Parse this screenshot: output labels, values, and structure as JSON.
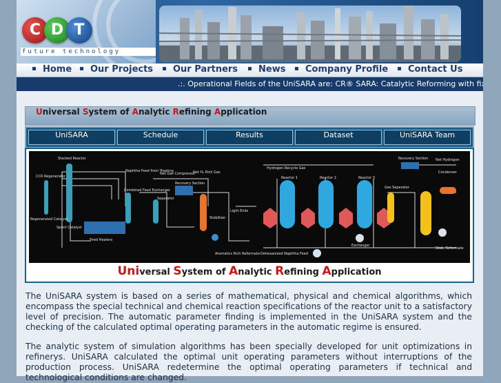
{
  "header": {
    "logo": {
      "letters": [
        "C",
        "D",
        "T"
      ],
      "tagline": "future technology"
    }
  },
  "nav": {
    "items": [
      "Home",
      "Our Projects",
      "Our Partners",
      "News",
      "Company Profile",
      "Contact Us"
    ]
  },
  "ticker": {
    "text": ".:. Operational Fields of the UniSARA are: CR® SARA: Catalytic Reforming with fixe"
  },
  "app": {
    "title_parts": [
      {
        "hl": "U",
        "rest": "niversal "
      },
      {
        "hl": "S",
        "rest": "ystem of "
      },
      {
        "hl": "A",
        "rest": "nalytic "
      },
      {
        "hl": "R",
        "rest": "efining "
      },
      {
        "hl": "A",
        "rest": "pplication"
      }
    ],
    "tabs": [
      "UniSARA",
      "Schedule",
      "Results",
      "Dataset",
      "UniSARA Team"
    ]
  },
  "diagram": {
    "caption_parts": [
      {
        "hl": "Uni",
        "rest": "versal "
      },
      {
        "hl": "S",
        "rest": "ystem of "
      },
      {
        "hl": "A",
        "rest": "nalytic "
      },
      {
        "hl": "R",
        "rest": "efining "
      },
      {
        "hl": "A",
        "rest": "pplication"
      }
    ],
    "labels": {
      "stacked_reactor": "Stacked Reactor",
      "ccr": "CCR Regenerator",
      "regen_catalyst": "Regenerated Catalyst",
      "spent_catalyst": "Spent Catalyst",
      "naphtha_feed": "Naphtha Feed from Treating",
      "combined_feed": "Combined Feed Exchanger",
      "fired_heaters": "Fired Heaters",
      "net_gas": "Net Gas Compressor",
      "net_h2": "Net H₂ Rich Gas",
      "recovery": "Recovery Section",
      "separator": "Separator",
      "light_ends": "Light Ends",
      "stabilizer": "Stabilizer",
      "aromatics": "Aromatics Rich Reformate",
      "h2_recycle": "Hydrogen Recycle Gas",
      "reactors": [
        "Reactor 1",
        "Reactor 2",
        "Reactor 3"
      ],
      "net_hydrogen": "Net Hydrogen",
      "condenser": "Condenser",
      "exchanger": "Exchanger",
      "desulf": "Dehexanized Naphtha Feed",
      "stab_reformate": "Stab. Reformate",
      "gas_separator": "Gas Separator",
      "recovery_section": "Recovery Section"
    }
  },
  "body": {
    "paragraphs": [
      "The UniSARA system is based on a series of mathematical, physical and chemical algorithms, which encompass the special technical and chemical reaction specifications of the reactor unit to a satisfactory level of precision. The automatic parameter finding is implemented in the UniSARA system and the checking of the calculated optimal operating parameters in the automatic regime is ensured.",
      "The analytic system of simulation algorithms has been specially developed for unit optimizations in refinerys. UniSARA calculated the optimal unit operating parameters without interruptions of the production process. UniSARA redetermine the optimal operating parameters if technical and technological conditions are changed."
    ]
  },
  "colors": {
    "accent": "#1d5e86",
    "highlight": "#c81818",
    "nav_text": "#1f3e6e"
  }
}
